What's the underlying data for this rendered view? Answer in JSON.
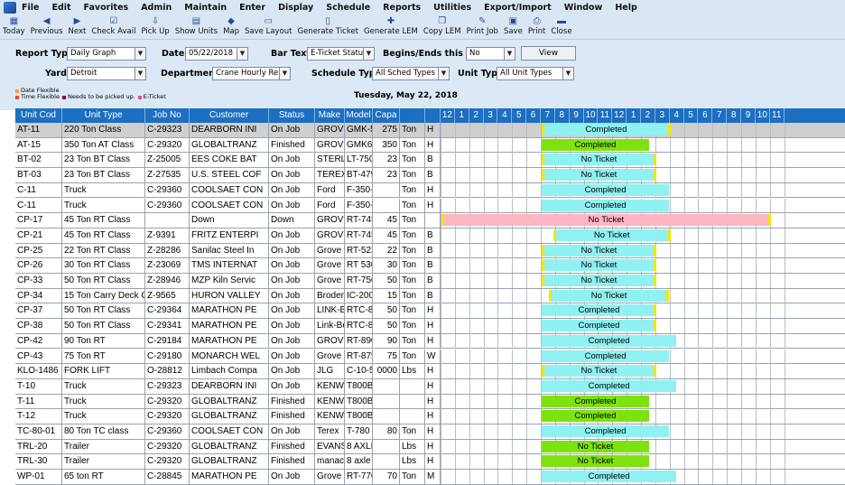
{
  "menu": [
    "File",
    "Edit",
    "Favorites",
    "Admin",
    "Maintain",
    "Enter",
    "Display",
    "Schedule",
    "Reports",
    "Utilities",
    "Export/Import",
    "Window",
    "Help"
  ],
  "toolbar": [
    {
      "label": "Today",
      "icon": "calendar-icon"
    },
    {
      "label": "Previous",
      "icon": "arrow-left-icon"
    },
    {
      "label": "Next",
      "icon": "arrow-right-icon"
    },
    {
      "label": "Check Avail",
      "icon": "checkbox-icon"
    },
    {
      "label": "Pick Up",
      "icon": "pickup-icon"
    },
    {
      "label": "Show Units",
      "icon": "units-icon"
    },
    {
      "label": "Map",
      "icon": "map-icon"
    },
    {
      "label": "Save Layout",
      "icon": "layout-icon"
    },
    {
      "label": "Generate Ticket",
      "icon": "ticket-icon"
    },
    {
      "label": "Generate LEM",
      "icon": "lem-icon"
    },
    {
      "label": "Copy LEM",
      "icon": "copy-icon"
    },
    {
      "label": "Print Job",
      "icon": "print-job-icon"
    },
    {
      "label": "Save",
      "icon": "save-icon"
    },
    {
      "label": "Print",
      "icon": "printer-icon"
    },
    {
      "label": "Close",
      "icon": "close-window-icon"
    }
  ],
  "filters": {
    "report_type_label": "Report Type",
    "report_type": "Daily Graph",
    "date_label": "Date",
    "date": "05/22/2018",
    "bar_text_label": "Bar Text",
    "bar_text": "E-Ticket Status",
    "begins_label": "Begins/Ends this Day",
    "begins": "No",
    "view_label": "View",
    "yard_label": "Yard",
    "yard": "Detroit",
    "department_label": "Department",
    "department": "Crane Hourly Rent",
    "schedule_type_label": "Schedule Type",
    "schedule_type": "All Sched Types",
    "unit_type_label": "Unit Type",
    "unit_type": "All Unit Types"
  },
  "legend": {
    "date_flexible": "Date Flexible",
    "time_flexible": "Time Flexible",
    "needs_pickup": "Needs to be picked up.",
    "eticket": "E-Ticket",
    "colors": {
      "date_flexible": "#f5a623",
      "time_flexible": "#e5473b",
      "needs_pickup": "#a0001c",
      "eticket": "#e94b8a"
    }
  },
  "date_heading": "Tuesday, May 22, 2018",
  "columns": [
    "Unit Cod",
    "Unit Type",
    "Job No",
    "Customer",
    "Status",
    "Make",
    "Model",
    "Capa",
    "",
    "",
    "12",
    "1",
    "2",
    "3",
    "4",
    "5",
    "6",
    "7",
    "8",
    "9",
    "10",
    "11",
    "12",
    "1",
    "2",
    "3",
    "4",
    "5",
    "6",
    "7",
    "8",
    "9",
    "10",
    "11"
  ],
  "rows": [
    {
      "unit": "AT-11",
      "type": "220 Ton Class",
      "job": "C-29323",
      "cust": "DEARBORN INI",
      "status": "On Job",
      "make": "GROVE",
      "model": "GMK-5",
      "cap": "275",
      "u": "Ton",
      "x": "H",
      "bar": {
        "text": "Completed",
        "color": "cyan",
        "from": 7,
        "to": 16,
        "left": true,
        "right": true,
        "eticket": true
      },
      "selected": true
    },
    {
      "unit": "AT-15",
      "type": "350 Ton AT Class",
      "job": "C-29320",
      "cust": "GLOBALTRANZ",
      "status": "Finished",
      "make": "GROVE",
      "model": "GMK63",
      "cap": "350",
      "u": "Ton",
      "x": "H",
      "bar": {
        "text": "Completed",
        "color": "green",
        "from": 7,
        "to": 14.5,
        "left": false,
        "right": false,
        "eticket": true
      }
    },
    {
      "unit": "BT-02",
      "type": "23 Ton BT Class",
      "job": "Z-25005",
      "cust": "EES COKE BAT",
      "status": "On Job",
      "make": "STERL",
      "model": "LT-750",
      "cap": "23",
      "u": "Ton",
      "x": "B",
      "bar": {
        "text": "No Ticket",
        "color": "cyan",
        "from": 7,
        "to": 15,
        "left": true,
        "right": true,
        "eticket": true
      }
    },
    {
      "unit": "BT-03",
      "type": "23 Ton BT Class",
      "job": "Z-27535",
      "cust": "U.S. STEEL COF",
      "status": "On Job",
      "make": "TEREX",
      "model": "BT-479",
      "cap": "23",
      "u": "Ton",
      "x": "B",
      "bar": {
        "text": "No Ticket",
        "color": "cyan",
        "from": 7,
        "to": 15,
        "left": true,
        "right": true,
        "eticket": false
      }
    },
    {
      "unit": "C-11",
      "type": "Truck",
      "job": "C-29360",
      "cust": "COOLSAET CON",
      "status": "On Job",
      "make": "Ford",
      "model": "F-350-",
      "cap": "",
      "u": "Ton",
      "x": "H",
      "bar": {
        "text": "Completed",
        "color": "cyan",
        "from": 7,
        "to": 15.9,
        "left": false,
        "right": false,
        "eticket": true
      }
    },
    {
      "unit": "C-11",
      "type": "Truck",
      "job": "C-29360",
      "cust": "COOLSAET CON",
      "status": "On Job",
      "make": "Ford",
      "model": "F-350-",
      "cap": "",
      "u": "Ton",
      "x": "H",
      "bar": {
        "text": "Completed",
        "color": "cyan",
        "from": 7,
        "to": 15.9,
        "left": false,
        "right": false,
        "eticket": true
      }
    },
    {
      "unit": "CP-17",
      "type": "45 Ton RT Class",
      "job": "",
      "cust": "Down",
      "status": "Down",
      "make": "GROVE",
      "model": "RT-745",
      "cap": "45",
      "u": "Ton",
      "x": "",
      "bar": {
        "text": "No Ticket",
        "color": "pink",
        "from": 0,
        "to": 23,
        "left": true,
        "right": true,
        "eticket": false
      }
    },
    {
      "unit": "CP-21",
      "type": "45 Ton RT Class",
      "job": "Z-9391",
      "cust": "FRITZ ENTERPI",
      "status": "On Job",
      "make": "GROVE",
      "model": "RT-745",
      "cap": "45",
      "u": "Ton",
      "x": "B",
      "bar": {
        "text": "No Ticket",
        "color": "cyan",
        "from": 7.8,
        "to": 16,
        "left": true,
        "right": true,
        "eticket": false
      }
    },
    {
      "unit": "CP-25",
      "type": "22 Ton RT Class",
      "job": "Z-28286",
      "cust": "Sanilac Steel In",
      "status": "On Job",
      "make": "Grove",
      "model": "RT-522",
      "cap": "22",
      "u": "Ton",
      "x": "B",
      "bar": {
        "text": "No Ticket",
        "color": "cyan",
        "from": 7,
        "to": 15,
        "left": true,
        "right": true,
        "eticket": false
      }
    },
    {
      "unit": "CP-26",
      "type": "30 Ton RT Class",
      "job": "Z-23069",
      "cust": "TMS INTERNAT",
      "status": "On Job",
      "make": "Grove",
      "model": "RT 530",
      "cap": "30",
      "u": "Ton",
      "x": "B",
      "bar": {
        "text": "No Ticket",
        "color": "cyan",
        "from": 7,
        "to": 15,
        "left": true,
        "right": true,
        "eticket": false
      }
    },
    {
      "unit": "CP-33",
      "type": "50 Ton RT Class",
      "job": "Z-28946",
      "cust": "MZP Kiln Servic",
      "status": "On Job",
      "make": "Grove",
      "model": "RT-750",
      "cap": "50",
      "u": "Ton",
      "x": "B",
      "bar": {
        "text": "No Ticket",
        "color": "cyan",
        "from": 7,
        "to": 15,
        "left": true,
        "right": true,
        "eticket": false
      }
    },
    {
      "unit": "CP-34",
      "type": "15 Ton Carry Deck C",
      "job": "Z-9565",
      "cust": "HURON VALLEY",
      "status": "On Job",
      "make": "Broder",
      "model": "IC-200",
      "cap": "15",
      "u": "Ton",
      "x": "B",
      "bar": {
        "text": "No Ticket",
        "color": "cyan",
        "from": 7.5,
        "to": 15.9,
        "left": true,
        "right": true,
        "eticket": false
      }
    },
    {
      "unit": "CP-37",
      "type": "50 Ton RT Class",
      "job": "C-29364",
      "cust": "MARATHON PE",
      "status": "On Job",
      "make": "LINK-B",
      "model": "RTC-80",
      "cap": "50",
      "u": "Ton",
      "x": "H",
      "bar": {
        "text": "Completed",
        "color": "cyan",
        "from": 7,
        "to": 15,
        "left": false,
        "right": true,
        "eticket": true
      }
    },
    {
      "unit": "CP-38",
      "type": "50 Ton RT Class",
      "job": "C-29341",
      "cust": "MARATHON PE",
      "status": "On Job",
      "make": "Link-Be",
      "model": "RTC-80",
      "cap": "50",
      "u": "Ton",
      "x": "H",
      "bar": {
        "text": "Completed",
        "color": "cyan",
        "from": 7,
        "to": 15,
        "left": false,
        "right": true,
        "eticket": true
      }
    },
    {
      "unit": "CP-42",
      "type": "90 Ton RT",
      "job": "C-29184",
      "cust": "MARATHON PE",
      "status": "On Job",
      "make": "GROVE",
      "model": "RT-890",
      "cap": "90",
      "u": "Ton",
      "x": "H",
      "bar": {
        "text": "Completed",
        "color": "cyan",
        "from": 7,
        "to": 16.4,
        "left": false,
        "right": false,
        "eticket": true
      }
    },
    {
      "unit": "CP-43",
      "type": "75 Ton RT",
      "job": "C-29180",
      "cust": "MONARCH WEL",
      "status": "On Job",
      "make": "Grove",
      "model": "RT-875",
      "cap": "75",
      "u": "Ton",
      "x": "W",
      "bar": {
        "text": "Completed",
        "color": "cyan",
        "from": 7,
        "to": 15.9,
        "left": false,
        "right": false,
        "eticket": true
      }
    },
    {
      "unit": "KLO-1486",
      "type": "FORK LIFT",
      "job": "O-28812",
      "cust": "Limbach Compa",
      "status": "On Job",
      "make": "JLG",
      "model": "C-10-5",
      "cap": "0000",
      "u": "Lbs",
      "x": "H",
      "bar": {
        "text": "No Ticket",
        "color": "cyan",
        "from": 7,
        "to": 15,
        "left": true,
        "right": true,
        "eticket": false
      }
    },
    {
      "unit": "T-10",
      "type": "Truck",
      "job": "C-29323",
      "cust": "DEARBORN INI",
      "status": "On Job",
      "make": "KENW(",
      "model": "T800B",
      "cap": "",
      "u": "",
      "x": "H",
      "bar": {
        "text": "Completed",
        "color": "cyan",
        "from": 7,
        "to": 16.4,
        "left": false,
        "right": false,
        "eticket": true
      }
    },
    {
      "unit": "T-11",
      "type": "Truck",
      "job": "C-29320",
      "cust": "GLOBALTRANZ",
      "status": "Finished",
      "make": "KENW(",
      "model": "T800B",
      "cap": "",
      "u": "",
      "x": "H",
      "bar": {
        "text": "Completed",
        "color": "green",
        "from": 7,
        "to": 14.5,
        "left": false,
        "right": false,
        "eticket": true
      }
    },
    {
      "unit": "T-12",
      "type": "Truck",
      "job": "C-29320",
      "cust": "GLOBALTRANZ",
      "status": "Finished",
      "make": "KENW(",
      "model": "T800B",
      "cap": "",
      "u": "",
      "x": "H",
      "bar": {
        "text": "Completed",
        "color": "green",
        "from": 7,
        "to": 14.5,
        "left": false,
        "right": false,
        "eticket": true
      }
    },
    {
      "unit": "TC-80-01",
      "type": "80 Ton TC class",
      "job": "C-29360",
      "cust": "COOLSAET CON",
      "status": "On Job",
      "make": "Terex",
      "model": "T-780",
      "cap": "80",
      "u": "Ton",
      "x": "H",
      "bar": {
        "text": "Completed",
        "color": "cyan",
        "from": 7,
        "to": 15.9,
        "left": false,
        "right": false,
        "eticket": true
      }
    },
    {
      "unit": "TRL-20",
      "type": "Trailer",
      "job": "C-29320",
      "cust": "GLOBALTRANZ",
      "status": "Finished",
      "make": "EVANS",
      "model": "8 AXLE",
      "cap": "",
      "u": "Lbs",
      "x": "H",
      "bar": {
        "text": "No Ticket",
        "color": "green",
        "from": 7,
        "to": 14.5,
        "left": false,
        "right": false,
        "eticket": false
      }
    },
    {
      "unit": "TRL-30",
      "type": "Trailer",
      "job": "C-29320",
      "cust": "GLOBALTRANZ",
      "status": "Finished",
      "make": "manac",
      "model": "8 axle",
      "cap": "",
      "u": "Lbs",
      "x": "H",
      "bar": {
        "text": "No Ticket",
        "color": "green",
        "from": 7,
        "to": 14.5,
        "left": false,
        "right": false,
        "eticket": false
      }
    },
    {
      "unit": "WP-01",
      "type": "65 ton RT",
      "job": "C-28845",
      "cust": "MARATHON PE",
      "status": "On Job",
      "make": "Grove",
      "model": "RT-770",
      "cap": "70",
      "u": "Ton",
      "x": "M",
      "bar": {
        "text": "Completed",
        "color": "cyan",
        "from": 7,
        "to": 16.4,
        "left": false,
        "right": false,
        "eticket": true
      }
    }
  ]
}
